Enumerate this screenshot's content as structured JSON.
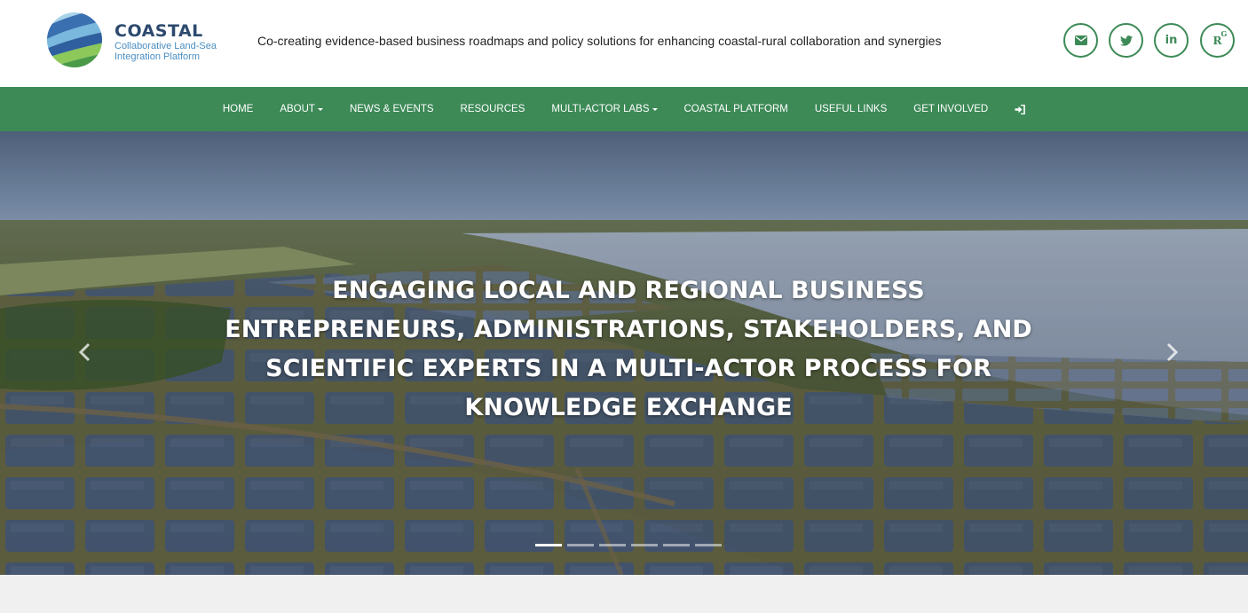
{
  "brand": {
    "name": "COASTAL",
    "subtitle_line1": "Collaborative Land-Sea",
    "subtitle_line2": "Integration Platform",
    "tagline": "Co-creating evidence-based business roadmaps and policy solutions for enhancing coastal-rural collaboration and synergies"
  },
  "social": [
    {
      "name": "email-icon",
      "label": ""
    },
    {
      "name": "twitter-icon",
      "label": ""
    },
    {
      "name": "linkedin-icon",
      "label": "in"
    },
    {
      "name": "researchgate-icon",
      "label": "R",
      "sup": "G"
    }
  ],
  "nav": {
    "items": [
      {
        "label": "HOME",
        "dropdown": false
      },
      {
        "label": "ABOUT",
        "dropdown": true
      },
      {
        "label": "NEWS & EVENTS",
        "dropdown": false
      },
      {
        "label": "RESOURCES",
        "dropdown": false
      },
      {
        "label": "MULTI-ACTOR LABS",
        "dropdown": true
      },
      {
        "label": "COASTAL PLATFORM",
        "dropdown": false
      },
      {
        "label": "USEFUL LINKS",
        "dropdown": false
      },
      {
        "label": "GET INVOLVED",
        "dropdown": false
      }
    ],
    "login_icon": "sign-in-icon"
  },
  "hero": {
    "caption": "ENGAGING LOCAL AND REGIONAL BUSINESS ENTREPRENEURS, ADMINISTRATIONS, STAKEHOLDERS, AND SCIENTIFIC EXPERTS IN A MULTI-ACTOR PROCESS FOR KNOWLEDGE EXCHANGE",
    "slide_count": 6,
    "active_slide": 1
  },
  "colors": {
    "nav_green": "#3d8a57",
    "brand_navy": "#2d4a6e",
    "brand_blue": "#4a8ec2"
  }
}
